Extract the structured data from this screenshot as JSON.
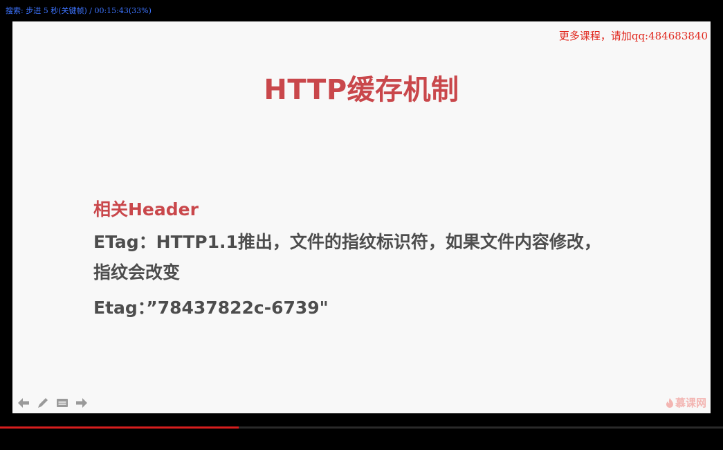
{
  "status_bar": {
    "text": "搜索: 步进 5 秒(关键帧) / 00:15:43(33%)"
  },
  "slide": {
    "promo": "更多课程，请加qq:484683840",
    "title": "HTTP缓存机制",
    "section_heading": "相关Header",
    "lines": [
      "ETag：HTTP1.1推出，文件的指纹标识符，如果文件内容修改，",
      "指纹会改变",
      "Etag：”78437822c-6739\""
    ],
    "logo": "慕课网"
  },
  "toolbar": {
    "icons": [
      "arrow-left-icon",
      "pen-icon",
      "menu-icon",
      "arrow-right-icon"
    ]
  },
  "playback": {
    "progress": 0.33
  },
  "colors": {
    "title_red": "#c9474b",
    "status_blue": "#3d74ff",
    "promo_red": "#e0281e",
    "progress_red": "#d81e1e"
  }
}
